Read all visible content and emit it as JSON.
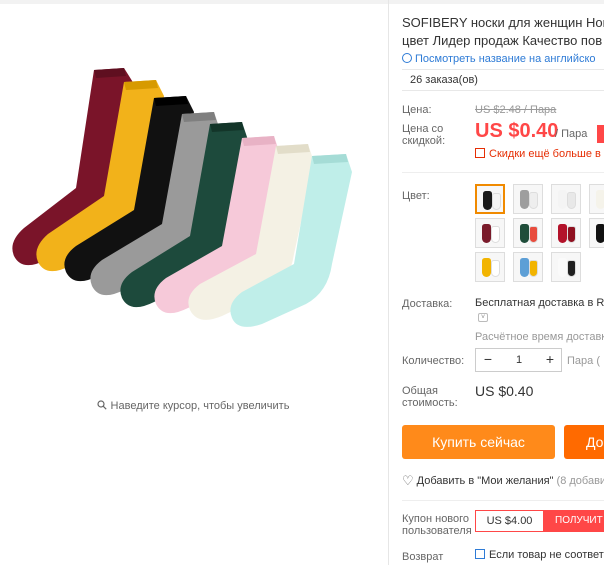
{
  "product": {
    "title_line1": "SOFIBERY носки для женщин Нові",
    "title_line2": "цвет Лидер продаж Качество пов",
    "translate_link": "Посмотреть название на английско",
    "orders": "26 заказа(ов)",
    "image_zoom_hint": "Наведите курсор, чтобы увеличить"
  },
  "pricing": {
    "price_label": "Цена:",
    "old_price": "US $2.48 / Пара",
    "discount_label": "Цена со скидкой:",
    "price": "US $0.40",
    "unit": "/ Пара",
    "promo_text": "Скидки ещё больше в п",
    "accent_color": "#ff4747"
  },
  "options": {
    "color_label": "Цвет:",
    "swatches": [
      {
        "name": "black-white",
        "c1": "#1a1a1a",
        "c2": "#f5f5f5",
        "selected": true
      },
      {
        "name": "grey-white",
        "c1": "#9e9e9e",
        "c2": "#eeeeee",
        "selected": false
      },
      {
        "name": "white",
        "c1": "#f4f4f4",
        "c2": "#e8e8e8",
        "selected": false
      },
      {
        "name": "white-cream",
        "c1": "#f5f3ea",
        "c2": "#ffffff",
        "selected": false
      },
      {
        "name": "wine-white",
        "c1": "#7a1b2b",
        "c2": "#ffffff",
        "selected": false
      },
      {
        "name": "green-stripe",
        "c1": "#1f4d3a",
        "c2": "#e84c3d",
        "selected": false
      },
      {
        "name": "red-pair",
        "c1": "#b3122a",
        "c2": "#8f1020",
        "selected": false
      },
      {
        "name": "black-green",
        "c1": "#111111",
        "c2": "#2f6b45",
        "selected": false
      },
      {
        "name": "yellow-white",
        "c1": "#f2b400",
        "c2": "#ffffff",
        "selected": false
      },
      {
        "name": "blue-yellow",
        "c1": "#5d9fd6",
        "c2": "#f2b400",
        "selected": false
      },
      {
        "name": "white-black",
        "c1": "#fafafa",
        "c2": "#202020",
        "selected": false
      }
    ]
  },
  "shipping": {
    "label": "Доставка:",
    "value": "Бесплатная доставка в R",
    "eta": "Расчётное время доставки"
  },
  "quantity": {
    "label": "Количество:",
    "value": "1",
    "unit": "Пара (",
    "minus": "−",
    "plus": "+"
  },
  "total": {
    "label": "Общая стоимость:",
    "value": "US $0.40"
  },
  "actions": {
    "buy_now": "Купить сейчас",
    "add_to_cart": "До",
    "wishlist": "Добавить в \"Мои желания\"",
    "wishlist_count": "(8 добави"
  },
  "coupon": {
    "label": "Купон нового пользователя",
    "value": "US $4.00",
    "get": "ПОЛУЧИТ"
  },
  "returns": {
    "label": "Возврат",
    "value": "Если товар не соответс"
  }
}
